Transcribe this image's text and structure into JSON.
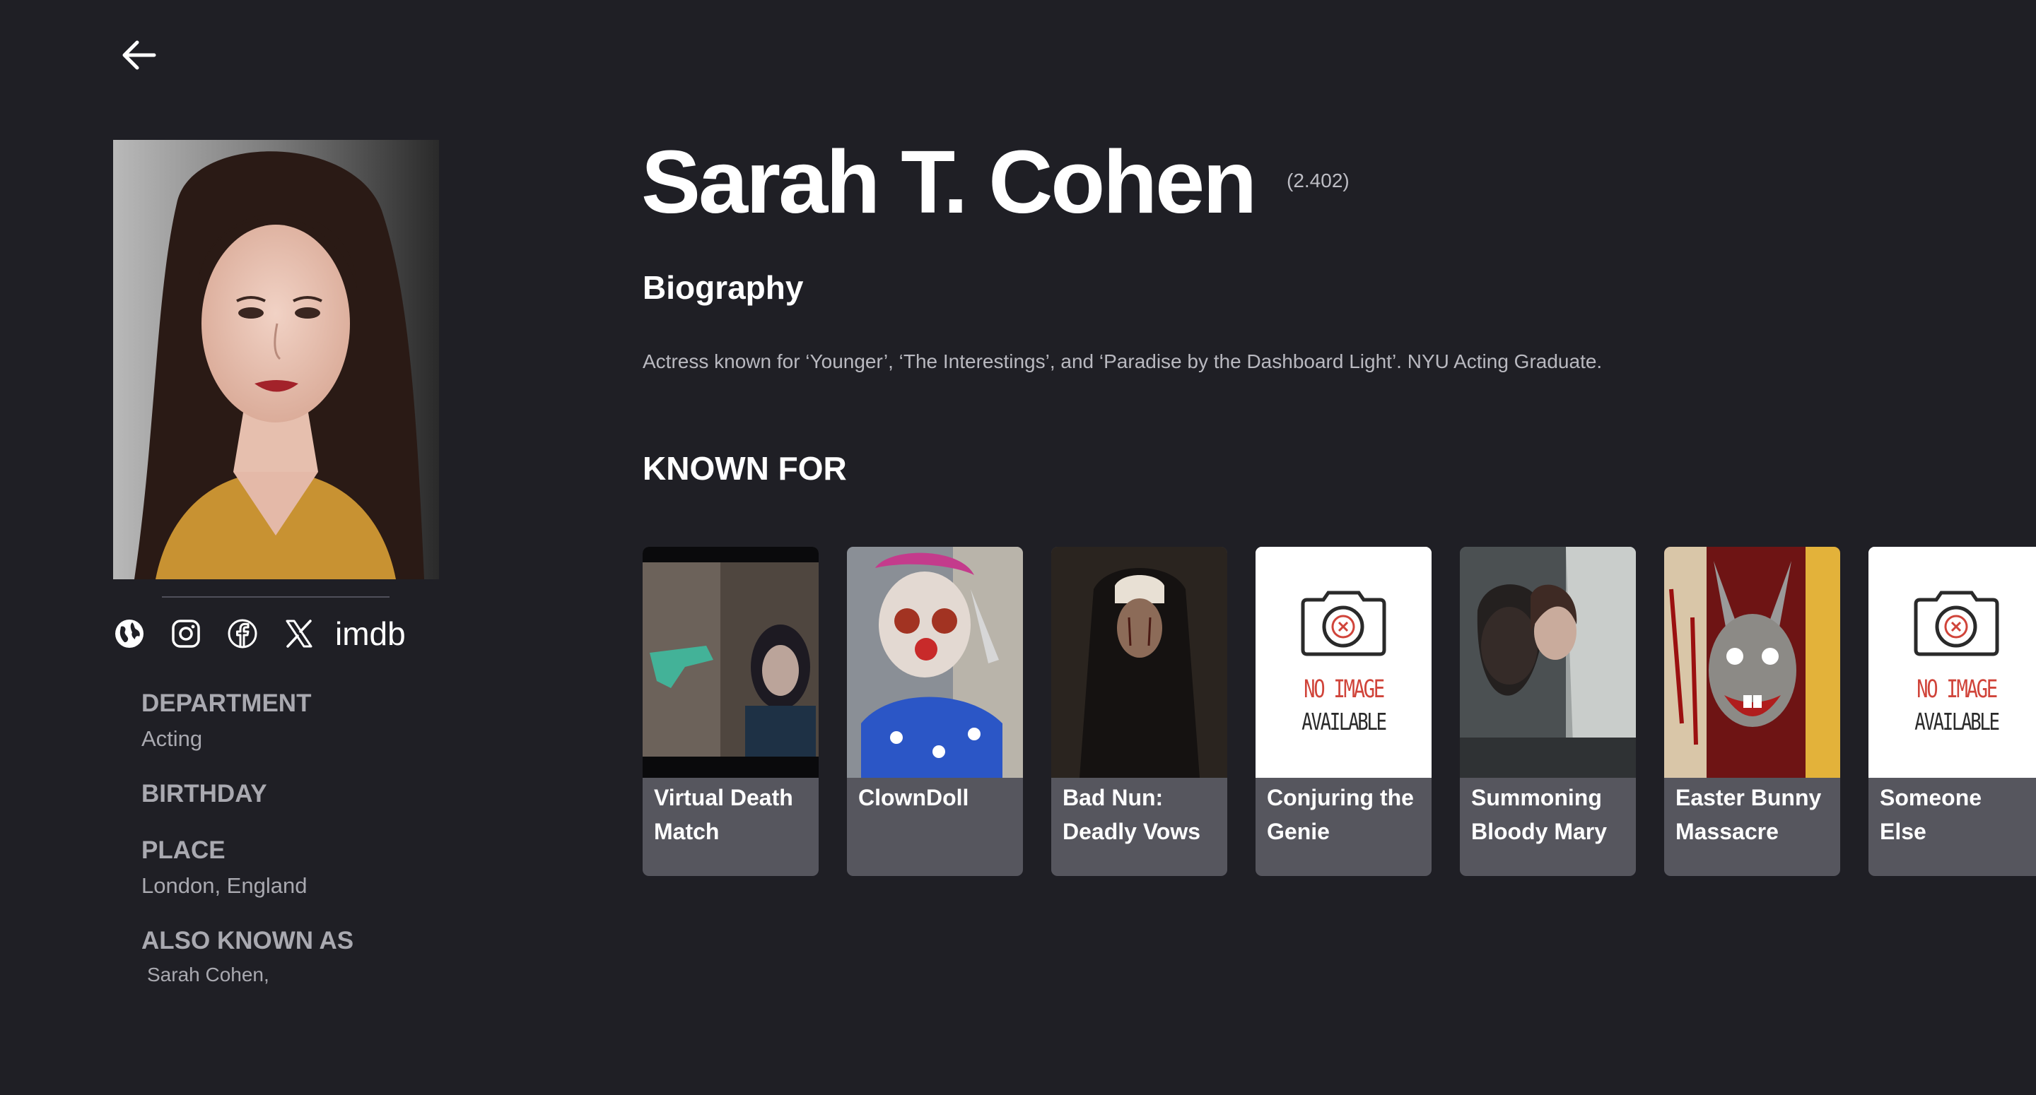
{
  "person": {
    "name": "Sarah T. Cohen",
    "popularity": "(2.402)",
    "biography_heading": "Biography",
    "biography": "Actress known for ‘Younger’, ‘The Interestings’, and ‘Paradise by the Dashboard Light’. NYU Acting Graduate.",
    "known_for_heading": "KNOWN FOR"
  },
  "social": {
    "imdb_label": "imdb",
    "icons": [
      "globe-icon",
      "instagram-icon",
      "facebook-icon",
      "x-icon"
    ]
  },
  "details": {
    "department_label": "DEPARTMENT",
    "department": "Acting",
    "birthday_label": "BIRTHDAY",
    "birthday": "",
    "place_label": "PLACE",
    "place": "London, England",
    "aka_label": "ALSO KNOWN AS",
    "aka": "Sarah Cohen,"
  },
  "known_for": [
    {
      "title": "Virtual Death Match",
      "poster": "image"
    },
    {
      "title": "ClownDoll",
      "poster": "image"
    },
    {
      "title": "Bad Nun: Deadly Vows",
      "poster": "image"
    },
    {
      "title": "Conjuring the Genie",
      "poster": "placeholder"
    },
    {
      "title": "Summoning Bloody Mary",
      "poster": "image"
    },
    {
      "title": "Easter Bunny Massacre",
      "poster": "image"
    },
    {
      "title": "Someone Else",
      "poster": "placeholder"
    }
  ],
  "placeholder_text": {
    "line1": "NO IMAGE",
    "line2": "AVAILABLE"
  },
  "colors": {
    "background": "#1f1f25",
    "card": "#56565e",
    "muted_text": "#a9a9b0",
    "placeholder_red": "#d0443a"
  }
}
